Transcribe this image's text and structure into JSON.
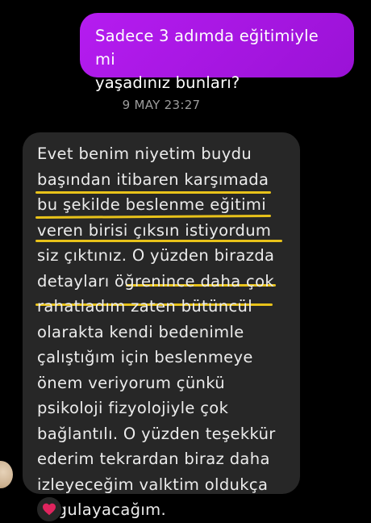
{
  "sent_message": {
    "text": "Sadece 3 adımda eğitimiyle mi\nyaşadınız bunları?"
  },
  "timestamp": "9 MAY 23:27",
  "received_message": {
    "lines": [
      "Evet benim niyetim buydu",
      "başından itibaren karşımada",
      "bu şekilde beslenme eğitimi",
      "veren birisi çıksın istiyordum",
      "siz çıktınız. O yüzden birazda",
      "detayları öğrenince daha çok",
      "rahatladım zaten bütüncül",
      "olarakta kendi bedenimle",
      "çalıştığım için beslenmeye",
      "önem veriyorum çünkü",
      "psikoloji fizyolojiyle çok",
      "bağlantılı. O yüzden teşekkür",
      "ederim tekrardan biraz daha",
      "izleyeceğim valktim oldukça",
      "uygulayacağım."
    ]
  },
  "reaction": {
    "icon": "heart-icon",
    "color": "#e0245e"
  },
  "colors": {
    "sent_bubble": "#b51cf0",
    "received_bubble": "#272727",
    "highlight": "#e8c21a",
    "background": "#000000"
  }
}
